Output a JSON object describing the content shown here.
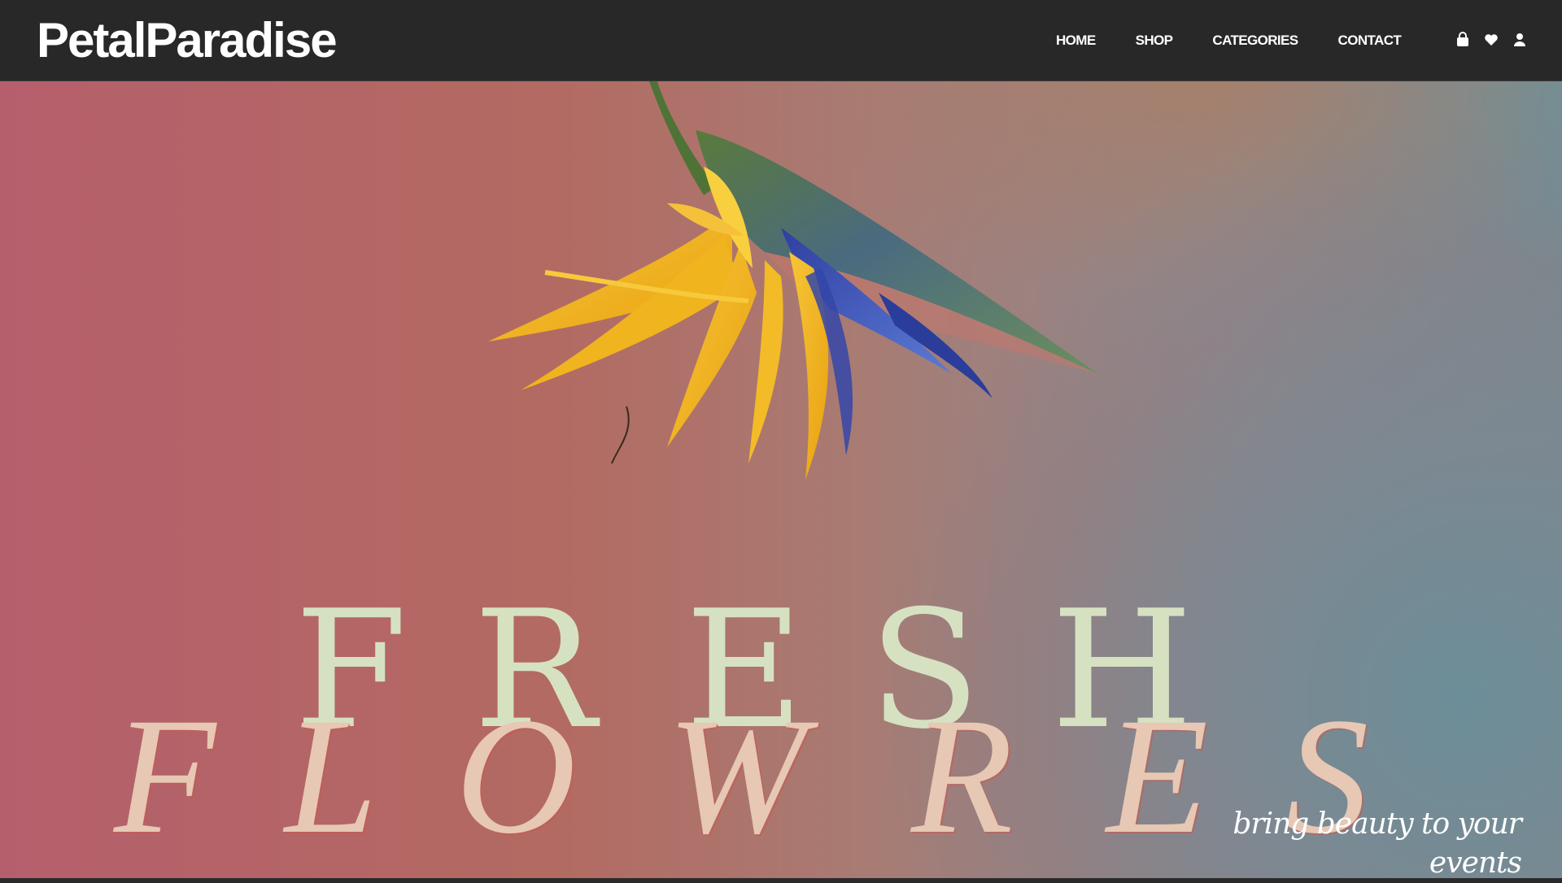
{
  "brand": {
    "name": "PetalParadise"
  },
  "nav": {
    "items": [
      {
        "label": "HOME"
      },
      {
        "label": "SHOP"
      },
      {
        "label": "CATEGORIES"
      },
      {
        "label": "CONTACT"
      }
    ]
  },
  "header_icons": [
    "bag-icon",
    "heart-icon",
    "user-icon"
  ],
  "hero": {
    "title_line1": [
      "F",
      "R",
      "E",
      "S",
      "H"
    ],
    "title_line2": [
      "F",
      "L",
      "O",
      "W",
      "R",
      "E",
      "S"
    ],
    "tagline": "bring beauty to your events",
    "image": "bird-of-paradise-flower"
  },
  "colors": {
    "header_bg": "#282828",
    "fresh_text": "#d6e1c2",
    "flowres_text": "#e6c8b4",
    "bg_left": "#b55f6c",
    "bg_right": "#6f8f98"
  }
}
